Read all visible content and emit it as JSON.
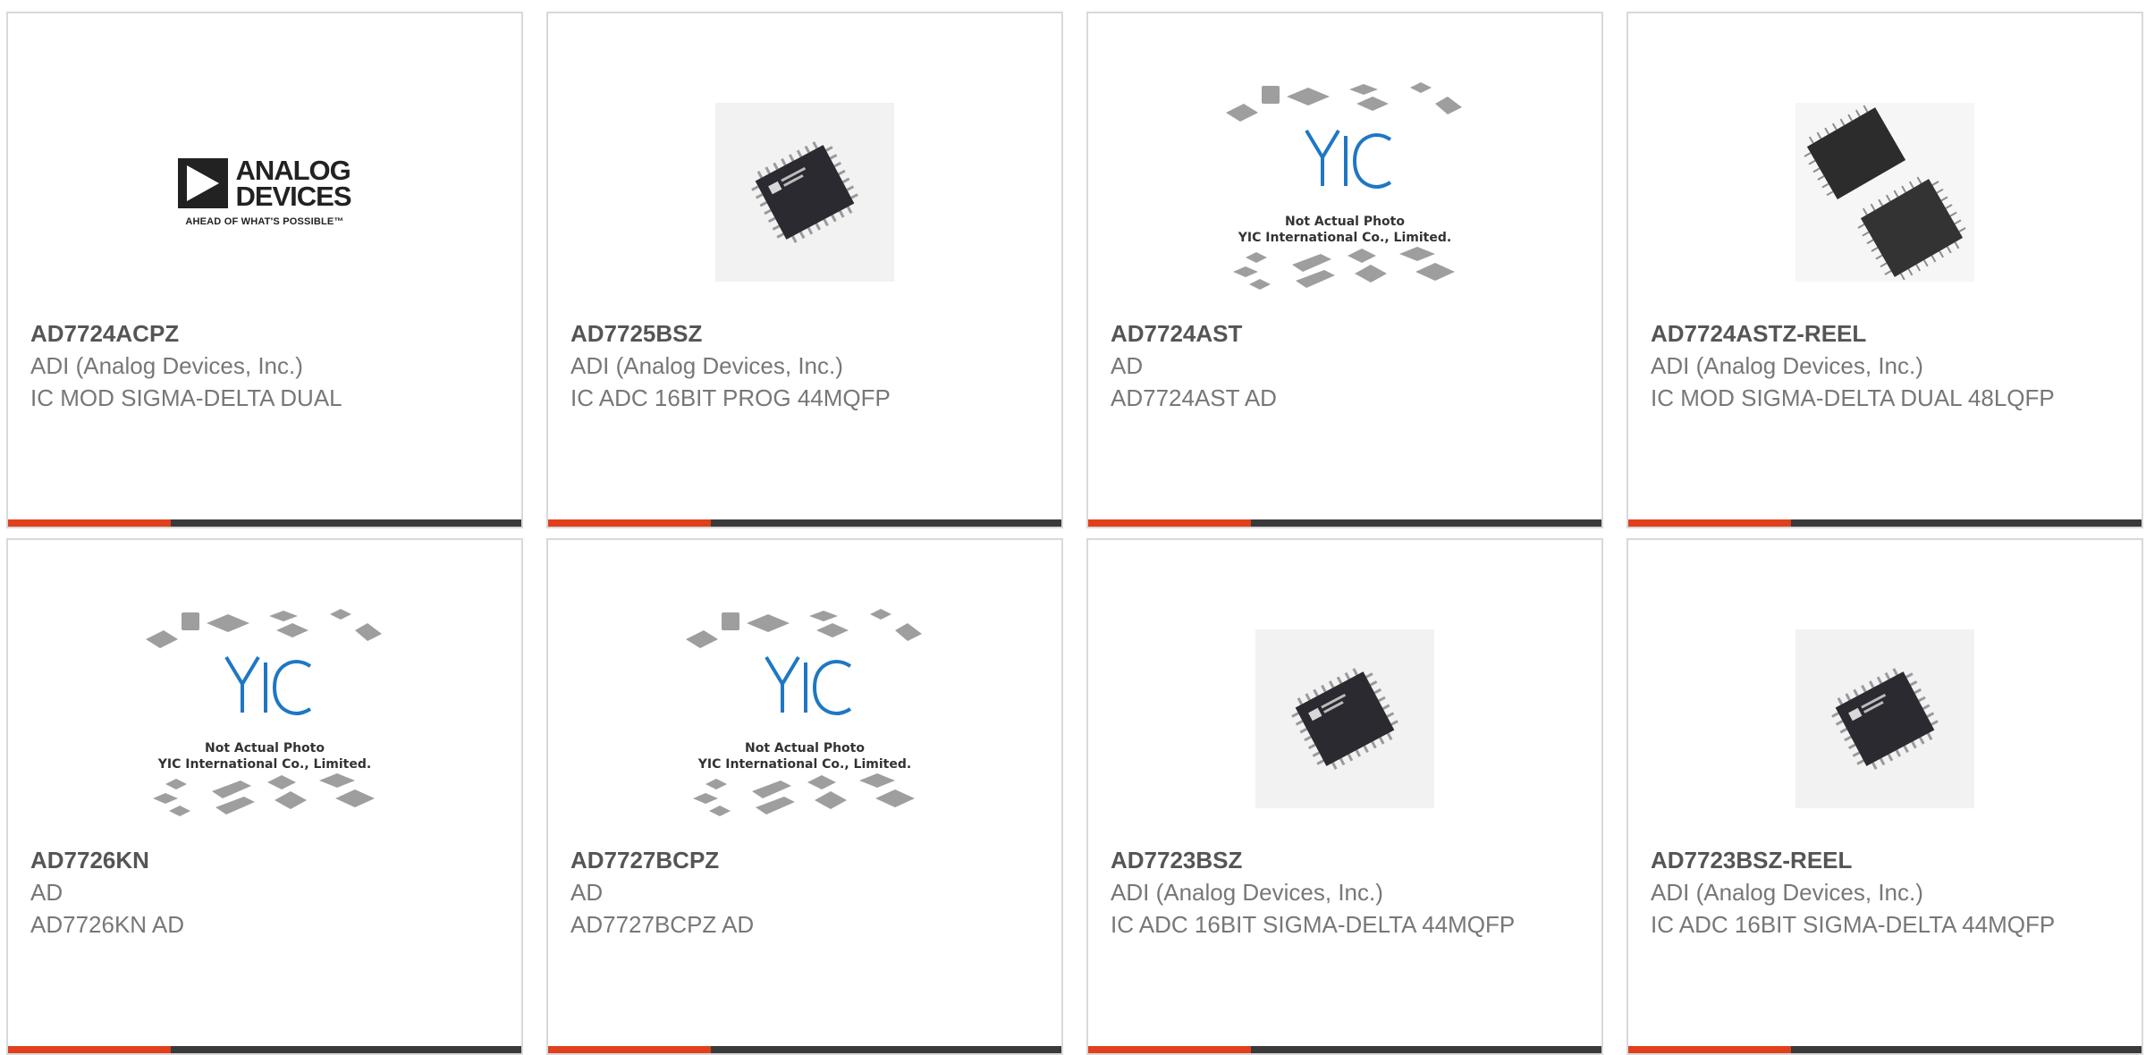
{
  "products": [
    {
      "part_number": "AD7724ACPZ",
      "manufacturer": "ADI (Analog Devices, Inc.)",
      "description": "IC MOD SIGMA-DELTA DUAL",
      "image": "adi-logo"
    },
    {
      "part_number": "AD7725BSZ",
      "manufacturer": "ADI (Analog Devices, Inc.)",
      "description": "IC ADC 16BIT PROG 44MQFP",
      "image": "chip-photo"
    },
    {
      "part_number": "AD7724AST",
      "manufacturer": "AD",
      "description": "AD7724AST AD",
      "image": "yic-placeholder"
    },
    {
      "part_number": "AD7724ASTZ-REEL",
      "manufacturer": "ADI (Analog Devices, Inc.)",
      "description": "IC MOD SIGMA-DELTA DUAL 48LQFP",
      "image": "chip-photo-dual"
    },
    {
      "part_number": "AD7726KN",
      "manufacturer": "AD",
      "description": "AD7726KN AD",
      "image": "yic-placeholder"
    },
    {
      "part_number": "AD7727BCPZ",
      "manufacturer": "AD",
      "description": "AD7727BCPZ AD",
      "image": "yic-placeholder"
    },
    {
      "part_number": "AD7723BSZ",
      "manufacturer": "ADI (Analog Devices, Inc.)",
      "description": "IC ADC 16BIT SIGMA-DELTA 44MQFP",
      "image": "chip-photo"
    },
    {
      "part_number": "AD7723BSZ-REEL",
      "manufacturer": "ADI (Analog Devices, Inc.)",
      "description": "IC ADC 16BIT SIGMA-DELTA 44MQFP",
      "image": "chip-photo"
    }
  ],
  "logo": {
    "line1": "ANALOG",
    "line2": "DEVICES",
    "tagline": "AHEAD OF WHAT'S POSSIBLE™"
  },
  "placeholder": {
    "brand": "YIC",
    "line1": "Not Actual Photo",
    "line2": "YIC International Co., Limited."
  },
  "colors": {
    "accent": "#e0401c",
    "bar": "#3a3a3a",
    "border": "#d9d9d9",
    "part_number": "#555555",
    "text": "#777777",
    "yic_blue": "#1f77c4"
  }
}
